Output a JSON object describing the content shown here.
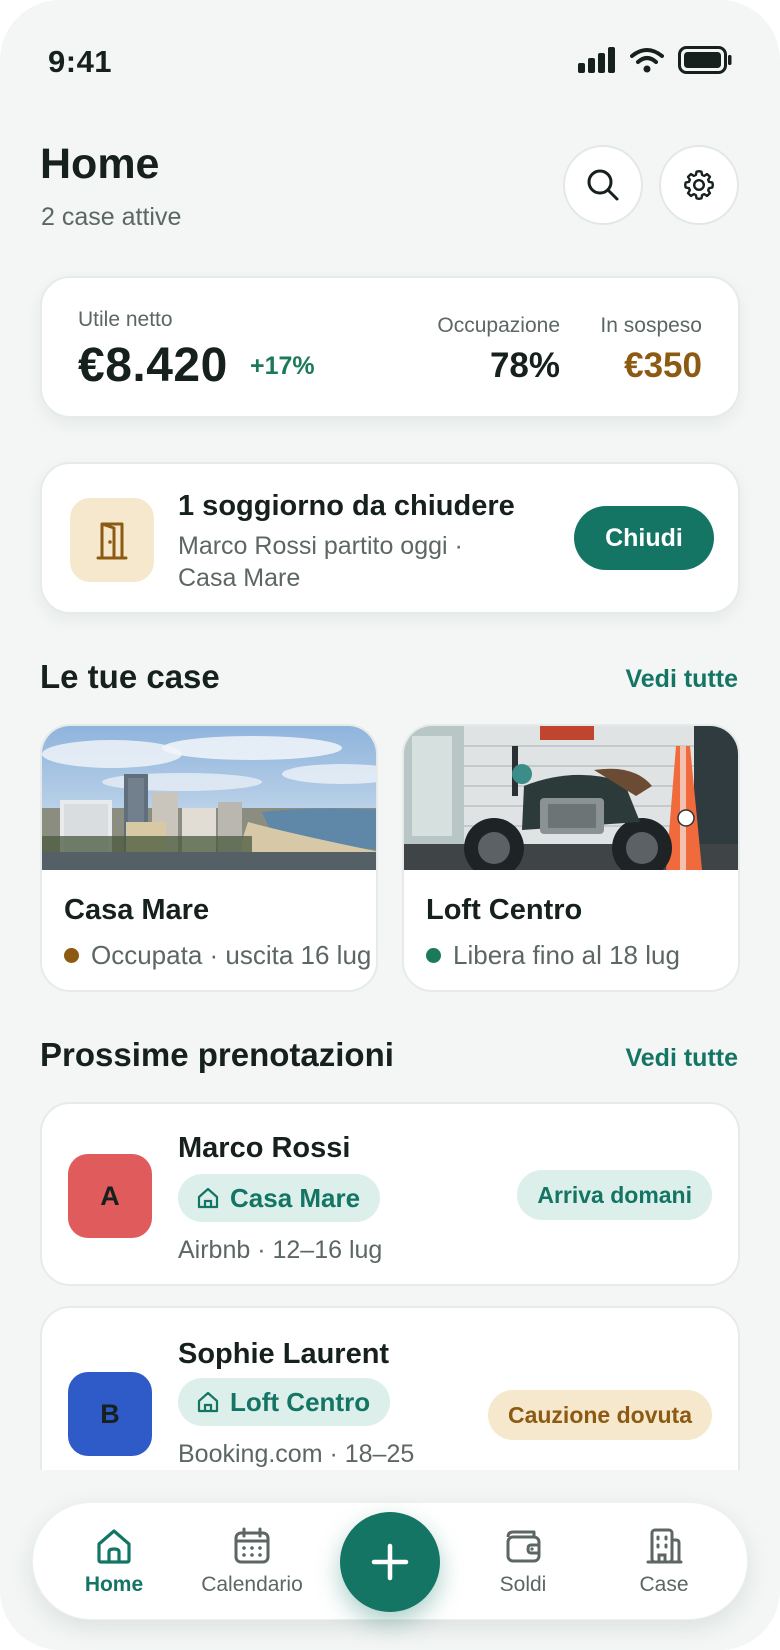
{
  "status_bar": {
    "time": "9:41"
  },
  "header": {
    "title": "Home",
    "subtitle": "2 case attive"
  },
  "summary": {
    "net_profit_label": "Utile netto",
    "net_profit_value": "€8.420",
    "net_profit_delta": "+17%",
    "occupancy_label": "Occupazione",
    "occupancy_value": "78%",
    "pending_label": "In sospeso",
    "pending_value": "€350"
  },
  "alert": {
    "title": "1 soggiorno da chiudere",
    "subtitle": "Marco Rossi partito oggi · Casa Mare",
    "button_label": "Chiudi",
    "icon": "door-icon"
  },
  "houses_section": {
    "title": "Le tue case",
    "link_label": "Vedi tutte",
    "items": [
      {
        "name": "Casa Mare",
        "status": "Occupata · uscita 16 lug",
        "status_color": "#8c5a12"
      },
      {
        "name": "Loft Centro",
        "status": "Libera fino al 18 lug",
        "status_color": "#1b7a5a"
      }
    ]
  },
  "bookings_section": {
    "title": "Prossime prenotazioni",
    "link_label": "Vedi tutte",
    "items": [
      {
        "avatar": "A",
        "avatar_color": "#e05b5b",
        "guest": "Marco Rossi",
        "house": "Casa Mare",
        "meta": "Airbnb · 12–16 lug",
        "status": "Arriva domani",
        "status_bg": "#dcefea",
        "status_color": "#147564"
      },
      {
        "avatar": "B",
        "avatar_color": "#2f5bc9",
        "guest": "Sophie Laurent",
        "house": "Loft Centro",
        "meta": "Booking.com · 18–25",
        "status": "Cauzione dovuta",
        "status_bg": "#f6e8cc",
        "status_color": "#8c5a12"
      }
    ]
  },
  "bottom_nav": {
    "items": [
      {
        "label": "Home",
        "icon": "home-icon",
        "active": true
      },
      {
        "label": "Calendario",
        "icon": "calendar-icon"
      },
      {
        "label": "Soldi",
        "icon": "wallet-icon"
      },
      {
        "label": "Case",
        "icon": "building-icon"
      }
    ],
    "fab_icon": "plus-icon"
  },
  "colors": {
    "accent": "#147564",
    "warning": "#8c5a12",
    "background": "#f3f6f5"
  }
}
